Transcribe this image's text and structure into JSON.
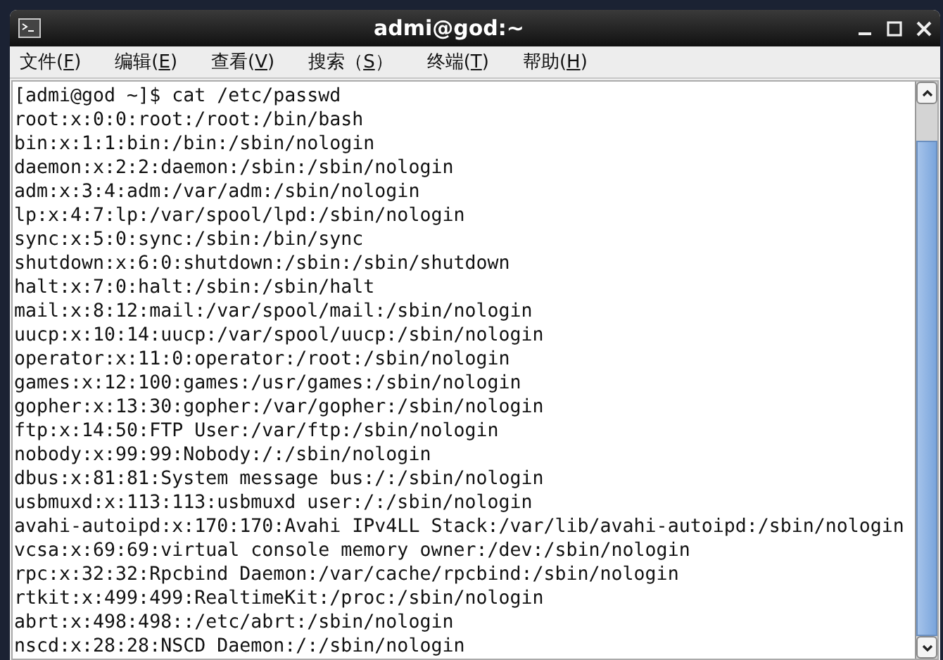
{
  "window": {
    "title": "admi@god:~"
  },
  "menu": [
    {
      "prefix": "文件(",
      "key": "F",
      "suffix": ")"
    },
    {
      "prefix": "编辑(",
      "key": "E",
      "suffix": ")"
    },
    {
      "prefix": "查看(",
      "key": "V",
      "suffix": ")"
    },
    {
      "prefix": "搜索（",
      "key": "S",
      "suffix": "）"
    },
    {
      "prefix": "终端(",
      "key": "T",
      "suffix": ")"
    },
    {
      "prefix": "帮助(",
      "key": "H",
      "suffix": ")"
    }
  ],
  "terminal": {
    "lines": [
      "[admi@god ~]$ cat /etc/passwd",
      "root:x:0:0:root:/root:/bin/bash",
      "bin:x:1:1:bin:/bin:/sbin/nologin",
      "daemon:x:2:2:daemon:/sbin:/sbin/nologin",
      "adm:x:3:4:adm:/var/adm:/sbin/nologin",
      "lp:x:4:7:lp:/var/spool/lpd:/sbin/nologin",
      "sync:x:5:0:sync:/sbin:/bin/sync",
      "shutdown:x:6:0:shutdown:/sbin:/sbin/shutdown",
      "halt:x:7:0:halt:/sbin:/sbin/halt",
      "mail:x:8:12:mail:/var/spool/mail:/sbin/nologin",
      "uucp:x:10:14:uucp:/var/spool/uucp:/sbin/nologin",
      "operator:x:11:0:operator:/root:/sbin/nologin",
      "games:x:12:100:games:/usr/games:/sbin/nologin",
      "gopher:x:13:30:gopher:/var/gopher:/sbin/nologin",
      "ftp:x:14:50:FTP User:/var/ftp:/sbin/nologin",
      "nobody:x:99:99:Nobody:/:/sbin/nologin",
      "dbus:x:81:81:System message bus:/:/sbin/nologin",
      "usbmuxd:x:113:113:usbmuxd user:/:/sbin/nologin",
      "avahi-autoipd:x:170:170:Avahi IPv4LL Stack:/var/lib/avahi-autoipd:/sbin/nologin",
      "vcsa:x:69:69:virtual console memory owner:/dev:/sbin/nologin",
      "rpc:x:32:32:Rpcbind Daemon:/var/cache/rpcbind:/sbin/nologin",
      "rtkit:x:499:499:RealtimeKit:/proc:/sbin/nologin",
      "abrt:x:498:498::/etc/abrt:/sbin/nologin",
      "nscd:x:28:28:NSCD Daemon:/:/sbin/nologin"
    ]
  }
}
